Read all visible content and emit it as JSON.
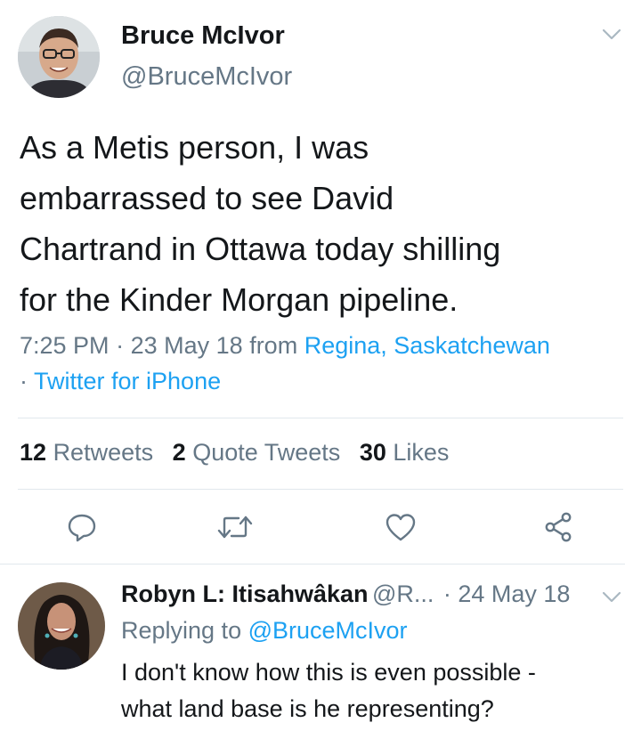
{
  "tweet": {
    "author_name": "Bruce McIvor",
    "author_handle": "@BruceMcIvor",
    "text_lines": [
      "As a Metis person, I was",
      "embarrassed to see David",
      "Chartrand in Ottawa today shilling",
      "for the Kinder Morgan pipeline."
    ],
    "time": "7:25 PM",
    "date": "23 May 18",
    "from_label": "from",
    "location": "Regina, Saskatchewan",
    "separator": "·",
    "source": "Twitter for iPhone"
  },
  "stats": {
    "retweets_count": "12",
    "retweets_label": "Retweets",
    "quotes_count": "2",
    "quotes_label": "Quote Tweets",
    "likes_count": "30",
    "likes_label": "Likes"
  },
  "actions": [
    "reply-icon",
    "retweet-icon",
    "like-icon",
    "share-icon"
  ],
  "reply": {
    "author_name": "Robyn L: Itisahwâkan",
    "author_handle": "@R...",
    "date": "· 24 May 18",
    "replying_label": "Replying to",
    "replying_to": "@BruceMcIvor",
    "text_lines": [
      "I don't know how this is even possible -",
      "what land base is he representing?"
    ]
  },
  "colors": {
    "link": "#1da1f2",
    "secondary": "#657786",
    "text": "#14171a",
    "icon": "#657786"
  }
}
